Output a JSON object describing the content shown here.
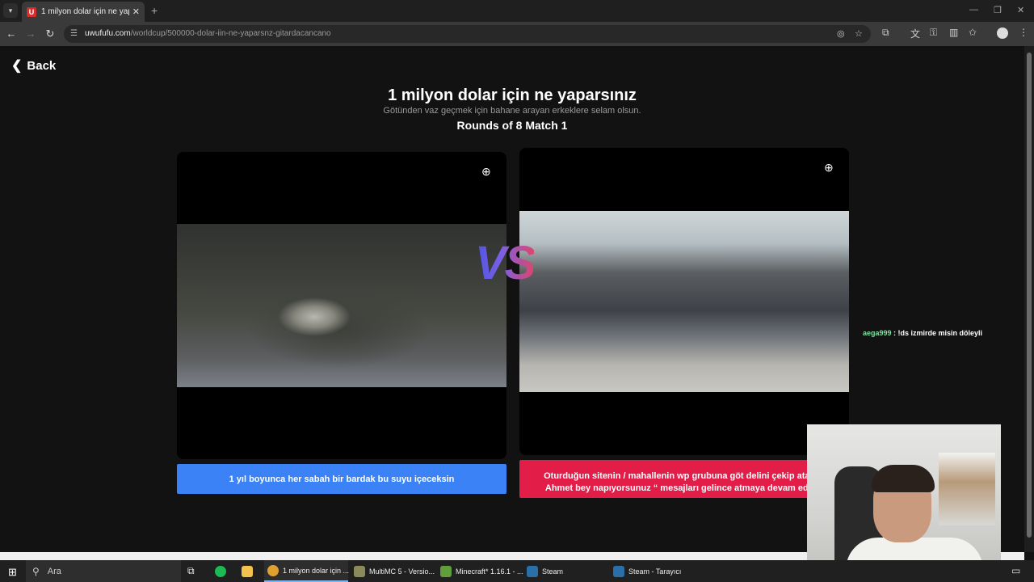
{
  "browser": {
    "tab_title": "1 milyon dolar için ne yaparsınız",
    "favicon_letter": "U",
    "url_host": "uwufufu.com",
    "url_path": "/worldcup/500000-dolar-iin-ne-yaparsnz-gitardacancano",
    "accent": "#d32f2f"
  },
  "page": {
    "back_label": "Back",
    "title": "1 milyon dolar için ne yaparsınız",
    "subtitle": "Götünden vaz geçmek için bahane arayan erkeklere selam olsun.",
    "round": "Rounds of 8 Match 1",
    "vs_label": "VS"
  },
  "choices": {
    "left_label": "1 yıl boyunca her sabah bir bardak bu suyu içeceksin",
    "left_color": "#3b82f6",
    "right_line1": "Oturduğun sitenin / mahallenin wp grubuna göt delini çekip atacak",
    "right_line2": "Ahmet bey napıyorsunuz “ mesajları gelince atmaya devam edece",
    "right_color": "#e11d48"
  },
  "chat": {
    "user": "aega999",
    "message": " : !ds izmirde misin döleyli"
  },
  "taskbar": {
    "search_placeholder": "Ara",
    "items": [
      {
        "label": "1 milyon dolar için ...",
        "icon": "chrome-icon",
        "color": "#e0a030"
      },
      {
        "label": "MultiMC 5 - Versio...",
        "icon": "multimc-icon",
        "color": "#8a8a5a"
      },
      {
        "label": "Minecraft* 1.16.1 - ...",
        "icon": "minecraft-icon",
        "color": "#5f9e3a"
      },
      {
        "label": "Steam",
        "icon": "steam-icon",
        "color": "#2a6fa8"
      },
      {
        "label": "Steam - Tarayıcı",
        "icon": "steam-icon",
        "color": "#2a6fa8"
      }
    ]
  }
}
